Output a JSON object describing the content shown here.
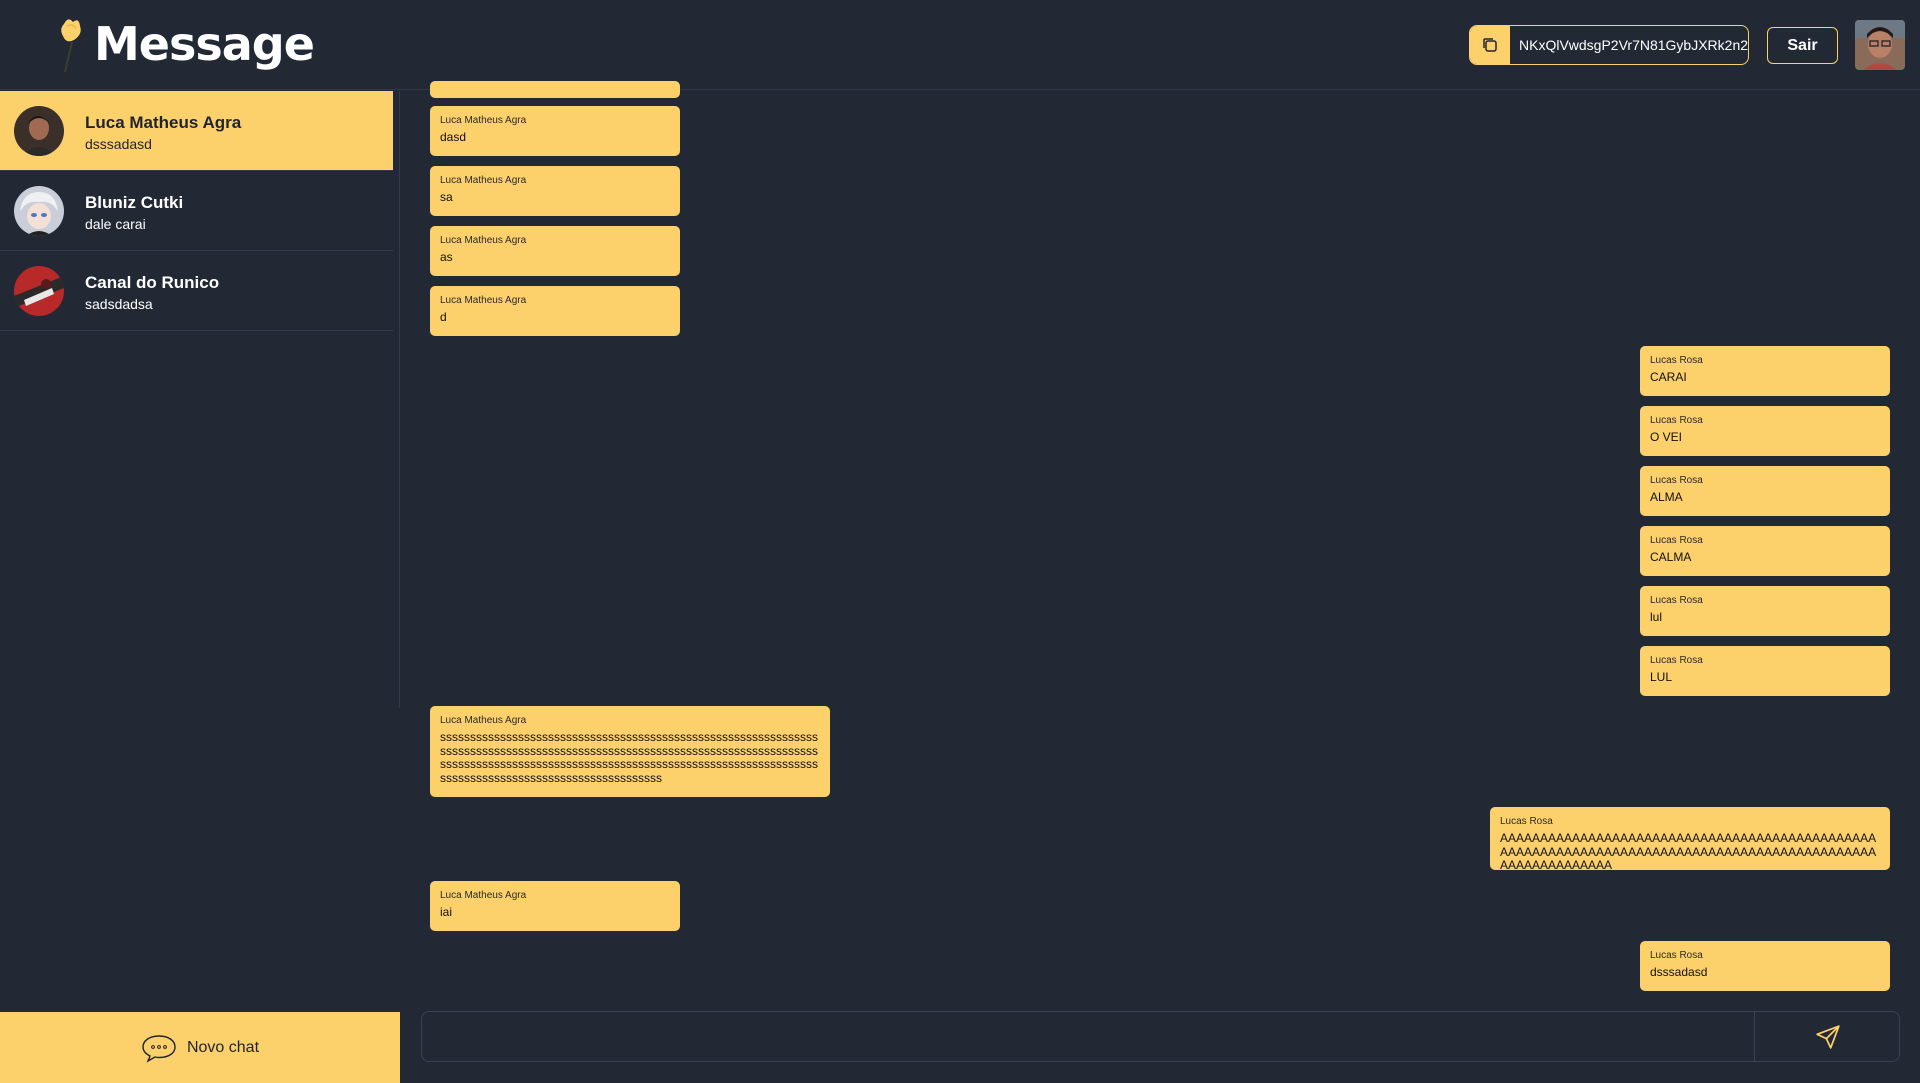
{
  "app": {
    "title": "Message"
  },
  "header": {
    "token": "NKxQlVwdsgP2Vr7N81GybJXRk2n2",
    "logout_label": "Sair",
    "copy_icon": "copy-icon"
  },
  "sidebar": {
    "chats": [
      {
        "name": "Luca Matheus Agra",
        "preview": "dsssadasd",
        "active": true
      },
      {
        "name": "Bluniz Cutki",
        "preview": "dale carai",
        "active": false
      },
      {
        "name": "Canal do Runico",
        "preview": "sadsdadsa",
        "active": false
      }
    ],
    "new_chat_label": "Novo chat"
  },
  "messages": [
    {
      "author": "Luca Matheus Agra",
      "text": "dasd"
    },
    {
      "author": "Luca Matheus Agra",
      "text": "sa"
    },
    {
      "author": "Luca Matheus Agra",
      "text": "as"
    },
    {
      "author": "Luca Matheus Agra",
      "text": "d"
    },
    {
      "author": "Lucas Rosa",
      "text": "CARAI"
    },
    {
      "author": "Lucas Rosa",
      "text": "O VEI"
    },
    {
      "author": "Lucas Rosa",
      "text": "ALMA"
    },
    {
      "author": "Lucas Rosa",
      "text": "CALMA"
    },
    {
      "author": "Lucas Rosa",
      "text": "lul"
    },
    {
      "author": "Lucas Rosa",
      "text": "LUL"
    },
    {
      "author": "Luca Matheus Agra",
      "text": "ssssssssssssssssssssssssssssssssssssssssssssssssssssssssssssssssssssssssssssssssssssssssssssssssssssssssssssssssssssssssssssssssssssssssssssssssssssssssssssssssssssssssssssssssssssssssssssssssssssssssssssssssssssssssssssssssss"
    },
    {
      "author": "Lucas Rosa",
      "text": "AAAAAAAAAAAAAAAAAAAAAAAAAAAAAAAAAAAAAAAAAAAAAAAAAAAAAAAAAAAAAAAAAAAAAAAAAAAAAAAAAAAAAAAAAAAAAAAAAAAAAAAAAAAA"
    },
    {
      "author": "Luca Matheus Agra",
      "text": "iai"
    },
    {
      "author": "Lucas Rosa",
      "text": "dsssadasd"
    }
  ],
  "composer": {
    "placeholder": "",
    "send_icon": "send-icon"
  },
  "colors": {
    "accent": "#fcd06a",
    "background": "#222834"
  }
}
